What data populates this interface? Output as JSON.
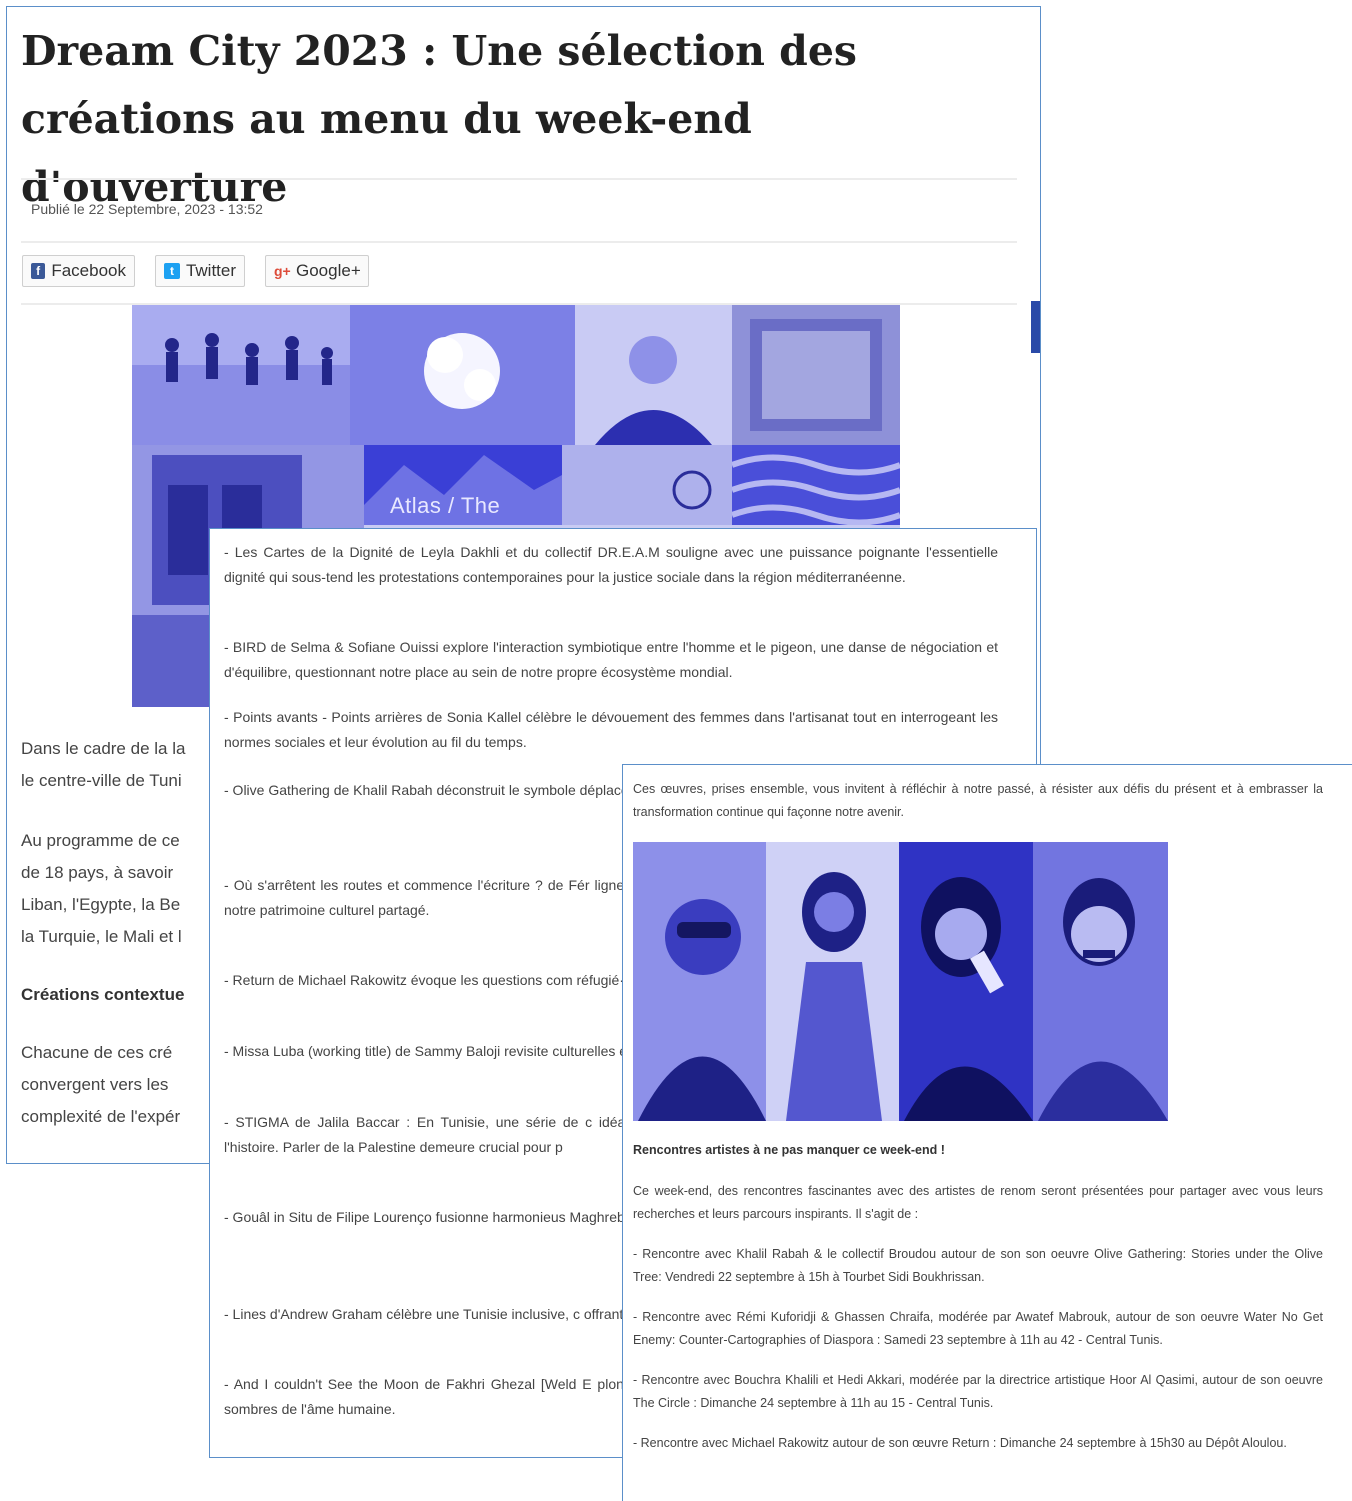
{
  "article": {
    "title": "Dream City 2023 : Une sélection des créations au menu du week-end d'ouverture",
    "published": "Publié le 22 Septembre, 2023 - 13:52",
    "share": {
      "facebook": "Facebook",
      "twitter": "Twitter",
      "google": "Google+"
    },
    "collage_caption": "Atlas / The",
    "partial_lines": [
      "Dans le cadre de la la",
      "le centre-ville de Tuni",
      "Au programme de ce",
      "de 18 pays, à savoir",
      "Liban, l'Egypte, la Be",
      "la Turquie, le Mali et l",
      "Créations contextue",
      "Chacune de ces cré",
      "convergent vers les",
      "complexité de l'expér"
    ]
  },
  "works": [
    "- Les Cartes de la Dignité de Leyla Dakhli et du collectif DR.E.A.M souligne avec une puissance poignante l'essentielle dignité qui sous-tend les protestations contemporaines pour la justice sociale dans la région méditerranéenne.",
    "- BIRD de Selma & Sofiane Ouissi explore l'interaction symbiotique entre l'homme et le pigeon, une danse de négociation et d'équilibre, questionnant notre place au sein de notre propre écosystème mondial.",
    "- Points avants - Points arrières de Sonia Kallel célèbre le dévouement des femmes dans l'artisanat tout en interrogeant les normes sociales et leur évolution au fil du temps.",
    "- Olive Gathering de Khalil Rabah déconstruit le symbole déplacement, tout en remettant en question notre perc millénaire.",
    "- Où s'arrêtent les routes et commence l'écriture ? de Fér lignes géographiques et linguistiques, symbolisant la t explorant notre patrimoine culturel partagé.",
    "- Return de Michael Rakowitz évoque les questions com réfugié·es, nous rappelant que chaque aspect de notre m",
    "- Missa Luba (working title) de Sammy Baloji revisite culturelles en Afrique, enrichissant notre compréhension c",
    "- STIGMA de Jalila Baccar : En Tunisie, une série de c idéaux et causes essentielles. Toutefois, Jalila Baccar rap de l'histoire. Parler de la Palestine demeure crucial pour p",
    "- Gouâl in Situ de Filipe Lourenço fusionne harmonieus Maghreb, célébrant la diversité corporelle et culturelle, significations.",
    "- Lines d'Andrew Graham célèbre une Tunisie inclusive, c offrant une vision inspirante de la solidarité et de l'apparte",
    "- And I couldn't See the Moon de Fakhri Ghezal [Weld E plongeant dans la mémoire de l'isolement carcéral et des plus sombres de l'âme humaine."
  ],
  "meetings": {
    "intro": "Ces œuvres, prises ensemble, vous invitent à réfléchir à notre passé, à résister aux défis du présent et à embrasser la transformation continue qui façonne notre avenir.",
    "heading": "Rencontres artistes à ne pas manquer ce week-end !",
    "lead": "Ce week-end, des rencontres fascinantes avec des artistes de renom seront présentées pour partager avec vous leurs recherches et leurs parcours inspirants. Il s'agit de :",
    "items": [
      "- Rencontre avec Khalil Rabah & le collectif Broudou autour de son son oeuvre Olive Gathering: Stories under the Olive Tree: Vendredi 22 septembre à 15h à Tourbet Sidi Boukhrissan.",
      "- Rencontre avec Rémi Kuforidji & Ghassen Chraifa, modérée par Awatef Mabrouk, autour de son oeuvre Water No Get Enemy: Counter-Cartographies of Diaspora : Samedi 23 septembre à 11h au 42 - Central Tunis.",
      "- Rencontre avec Bouchra Khalili et Hedi Akkari, modérée par la directrice artistique Hoor Al Qasimi, autour de son oeuvre The Circle : Dimanche 24 septembre à 11h au 15 - Central Tunis.",
      "- Rencontre avec Michael Rakowitz autour de son œuvre Return : Dimanche 24 septembre à 15h30 au Dépôt Aloulou."
    ]
  },
  "colors": {
    "panel_border": "#5b8fc9",
    "duotone_dark": "#3a3fd6",
    "duotone_light": "#c8cbf3",
    "facebook": "#3b5998",
    "twitter": "#1da1f2",
    "google": "#dd4b39"
  }
}
